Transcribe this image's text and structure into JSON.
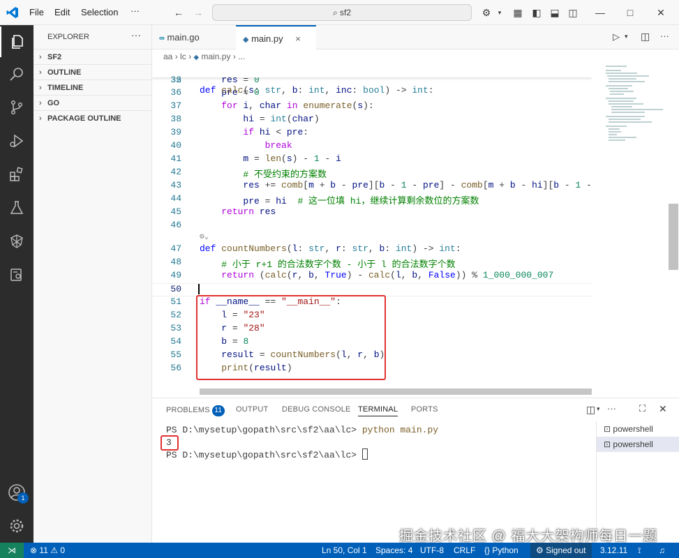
{
  "menu": {
    "file": "File",
    "edit": "Edit",
    "selection": "Selection",
    "more": "···"
  },
  "search": {
    "text": "sf2"
  },
  "sidebar": {
    "title": "EXPLORER",
    "more": "···",
    "sections": [
      "SF2",
      "OUTLINE",
      "TIMELINE",
      "GO",
      "PACKAGE OUTLINE"
    ]
  },
  "tabs": [
    {
      "label": "main.go",
      "icon": "go-file-icon"
    },
    {
      "label": "main.py",
      "icon": "python-file-icon",
      "close": "×"
    }
  ],
  "breadcrumb": {
    "p1": "aa",
    "p2": "lc",
    "p3": "main.py",
    "p4": "..."
  },
  "sticky": {
    "ln": "32"
  },
  "editor_lines": [
    {
      "ln": "35"
    },
    {
      "ln": "36"
    },
    {
      "ln": "37"
    },
    {
      "ln": "38"
    },
    {
      "ln": "39"
    },
    {
      "ln": "40"
    },
    {
      "ln": "41"
    },
    {
      "ln": "42"
    },
    {
      "ln": "43"
    },
    {
      "ln": "44"
    },
    {
      "ln": "45"
    },
    {
      "ln": "46"
    },
    {
      "ln": "47"
    },
    {
      "ln": "48"
    },
    {
      "ln": "49"
    },
    {
      "ln": "50"
    },
    {
      "ln": "51"
    },
    {
      "ln": "52"
    },
    {
      "ln": "53"
    },
    {
      "ln": "54"
    },
    {
      "ln": "55"
    },
    {
      "ln": "56"
    }
  ],
  "panel": {
    "tabs": [
      "PROBLEMS",
      "OUTPUT",
      "DEBUG CONSOLE",
      "TERMINAL",
      "PORTS"
    ],
    "problems_count": "11",
    "terminal_lines": {
      "prompt1": "PS D:\\mysetup\\gopath\\src\\sf2\\aa\\lc> ",
      "cmd1": "python main.py",
      "output": "3",
      "prompt2": "PS D:\\mysetup\\gopath\\src\\sf2\\aa\\lc> "
    },
    "terminals": [
      "powershell",
      "powershell"
    ]
  },
  "status": {
    "errors": "11",
    "warnings": "0",
    "position": "Ln 50, Col 1",
    "spaces": "Spaces: 4",
    "encoding": "UTF-8",
    "eol": "CRLF",
    "language": "Python",
    "account": "Signed out",
    "version": "3.12.11"
  },
  "account_badge": "1",
  "watermark": "掘金技术社区 @ 福大大架构师每日一题",
  "colors": {
    "accent": "#005fb8",
    "highlight_box": "#e03131"
  }
}
